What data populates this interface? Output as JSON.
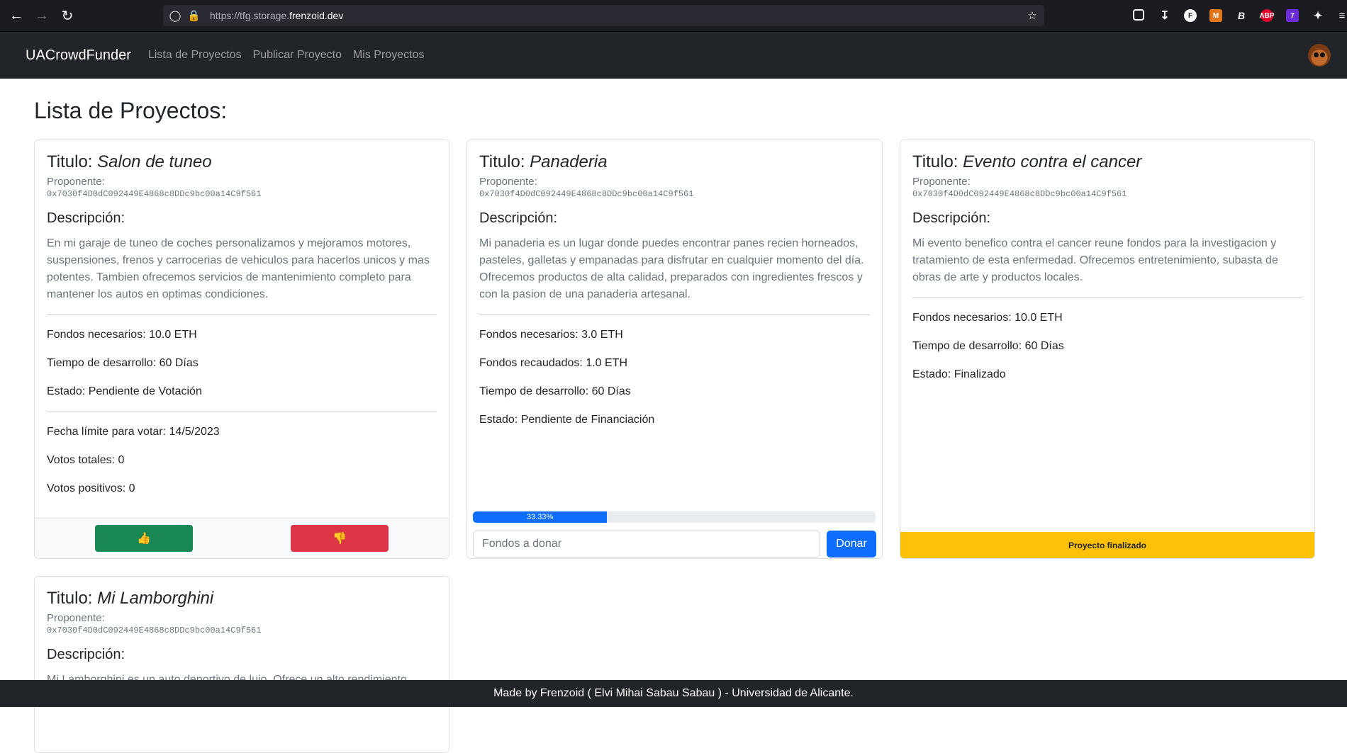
{
  "browser": {
    "url_prefix": "https://tfg.storage.",
    "url_domain": "frenzoid.dev",
    "extension_badge_count": "7"
  },
  "navbar": {
    "brand": "UACrowdFunder",
    "links": [
      "Lista de Proyectos",
      "Publicar Proyecto",
      "Mis Proyectos"
    ]
  },
  "page": {
    "title": "Lista de Proyectos:"
  },
  "common": {
    "title_prefix": "Titulo: ",
    "proponent_label": "Proponente:",
    "description_heading": "Descripción:"
  },
  "projects": [
    {
      "title": "Salon de tuneo",
      "proponent": "0x7030f4D0dC092449E4868c8DDc9bc00a14C9f561",
      "description": "En mi garaje de tuneo de coches personalizamos y mejoramos motores, suspensiones, frenos y carrocerias de vehiculos para hacerlos unicos y mas potentes. Tambien ofrecemos servicios de mantenimiento completo para mantener los autos en optimas condiciones.",
      "funds_needed": "Fondos necesarios: 10.0 ETH",
      "dev_time": "Tiempo de desarrollo: 60 Días",
      "status": "Estado: Pendiente de Votación",
      "vote_deadline": "Fecha límite para votar: 14/5/2023",
      "votes_total": "Votos totales: 0",
      "votes_positive": "Votos positivos: 0",
      "vote_up_icon": "👍",
      "vote_down_icon": "👎"
    },
    {
      "title": "Panaderia",
      "proponent": "0x7030f4D0dC092449E4868c8DDc9bc00a14C9f561",
      "description": "Mi panaderia es un lugar donde puedes encontrar panes recien horneados, pasteles, galletas y empanadas para disfrutar en cualquier momento del día. Ofrecemos productos de alta calidad, preparados con ingredientes frescos y con la pasion de una panaderia artesanal.",
      "funds_needed": "Fondos necesarios: 3.0 ETH",
      "funds_raised": "Fondos recaudados: 1.0 ETH",
      "dev_time": "Tiempo de desarrollo: 60 Días",
      "status": "Estado: Pendiente de Financiación",
      "progress_label": "33.33%",
      "progress_fraction": 0.3333,
      "donate_placeholder": "Fondos a donar",
      "donate_button": "Donar"
    },
    {
      "title": "Evento contra el cancer",
      "proponent": "0x7030f4D0dC092449E4868c8DDc9bc00a14C9f561",
      "description": "Mi evento benefico contra el cancer reune fondos para la investigacion y tratamiento de esta enfermedad. Ofrecemos entretenimiento, subasta de obras de arte y productos locales.",
      "funds_needed": "Fondos necesarios: 10.0 ETH",
      "dev_time": "Tiempo de desarrollo: 60 Días",
      "status": "Estado: Finalizado",
      "footer": "Proyecto finalizado"
    },
    {
      "title": "Mi Lamborghini",
      "proponent": "0x7030f4D0dC092449E4868c8DDc9bc00a14C9f561",
      "description": "Mi Lamborghini es un auto deportivo de lujo. Ofrece un alto rendimiento"
    }
  ],
  "footer": {
    "text": "Made by Frenzoid ( Elvi Mihai Sabau Sabau ) - Universidad de Alicante."
  }
}
